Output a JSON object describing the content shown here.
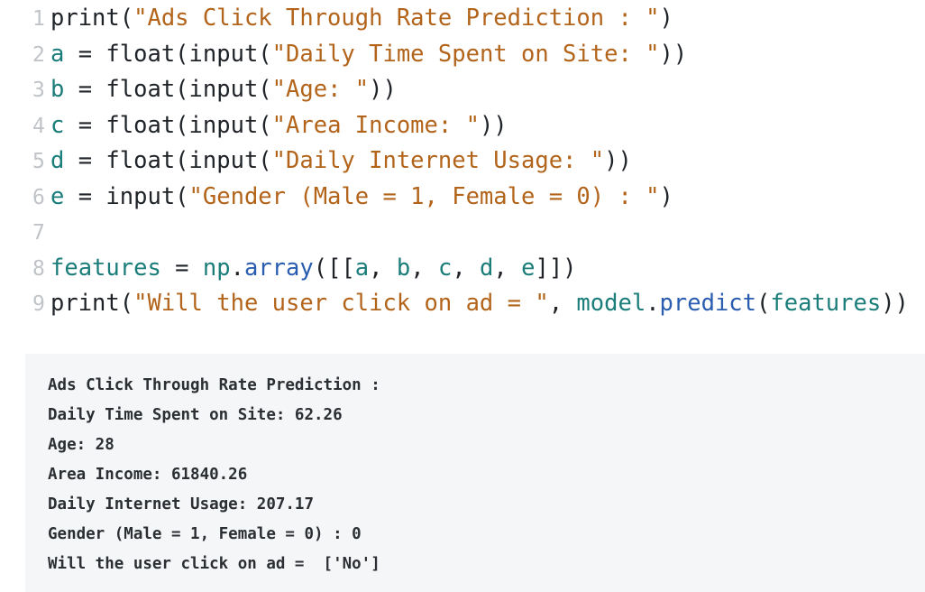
{
  "code": {
    "lines": [
      {
        "num": "1",
        "tokens": [
          {
            "t": "print(",
            "c": "fn"
          },
          {
            "t": "\"Ads Click Through Rate Prediction : \"",
            "c": "str"
          },
          {
            "t": ")",
            "c": "plain"
          }
        ]
      },
      {
        "num": "2",
        "tokens": [
          {
            "t": "a",
            "c": "var"
          },
          {
            "t": " = float(input(",
            "c": "plain"
          },
          {
            "t": "\"Daily Time Spent on Site: \"",
            "c": "str"
          },
          {
            "t": "))",
            "c": "plain"
          }
        ]
      },
      {
        "num": "3",
        "tokens": [
          {
            "t": "b",
            "c": "var"
          },
          {
            "t": " = float(input(",
            "c": "plain"
          },
          {
            "t": "\"Age: \"",
            "c": "str"
          },
          {
            "t": "))",
            "c": "plain"
          }
        ]
      },
      {
        "num": "4",
        "tokens": [
          {
            "t": "c",
            "c": "var"
          },
          {
            "t": " = float(input(",
            "c": "plain"
          },
          {
            "t": "\"Area Income: \"",
            "c": "str"
          },
          {
            "t": "))",
            "c": "plain"
          }
        ]
      },
      {
        "num": "5",
        "tokens": [
          {
            "t": "d",
            "c": "var"
          },
          {
            "t": " = float(input(",
            "c": "plain"
          },
          {
            "t": "\"Daily Internet Usage: \"",
            "c": "str"
          },
          {
            "t": "))",
            "c": "plain"
          }
        ]
      },
      {
        "num": "6",
        "tokens": [
          {
            "t": "e",
            "c": "var"
          },
          {
            "t": " = input(",
            "c": "plain"
          },
          {
            "t": "\"Gender (Male = 1, Female = 0) : \"",
            "c": "str"
          },
          {
            "t": ")",
            "c": "plain"
          }
        ]
      },
      {
        "num": "7",
        "tokens": []
      },
      {
        "num": "8",
        "tokens": [
          {
            "t": "features",
            "c": "var"
          },
          {
            "t": " = ",
            "c": "plain"
          },
          {
            "t": "np",
            "c": "var"
          },
          {
            "t": ".",
            "c": "plain"
          },
          {
            "t": "array",
            "c": "meth"
          },
          {
            "t": "([[",
            "c": "plain"
          },
          {
            "t": "a",
            "c": "var"
          },
          {
            "t": ", ",
            "c": "plain"
          },
          {
            "t": "b",
            "c": "var"
          },
          {
            "t": ", ",
            "c": "plain"
          },
          {
            "t": "c",
            "c": "var"
          },
          {
            "t": ", ",
            "c": "plain"
          },
          {
            "t": "d",
            "c": "var"
          },
          {
            "t": ", ",
            "c": "plain"
          },
          {
            "t": "e",
            "c": "var"
          },
          {
            "t": "]])",
            "c": "plain"
          }
        ]
      },
      {
        "num": "9",
        "tokens": [
          {
            "t": "print(",
            "c": "fn"
          },
          {
            "t": "\"Will the user click on ad = \"",
            "c": "str"
          },
          {
            "t": ", ",
            "c": "plain"
          },
          {
            "t": "model",
            "c": "var"
          },
          {
            "t": ".",
            "c": "plain"
          },
          {
            "t": "predict",
            "c": "meth"
          },
          {
            "t": "(",
            "c": "plain"
          },
          {
            "t": "features",
            "c": "var"
          },
          {
            "t": "))",
            "c": "plain"
          }
        ]
      }
    ]
  },
  "output": {
    "lines": [
      "Ads Click Through Rate Prediction :",
      "Daily Time Spent on Site: 62.26",
      "Age: 28",
      "Area Income: 61840.26",
      "Daily Internet Usage: 207.17",
      "Gender (Male = 1, Female = 0) : 0",
      "Will the user click on ad =  ['No']"
    ]
  },
  "colors": {
    "string": "#b3641b",
    "variable": "#1a7d7a",
    "method": "#2a5db0",
    "line_number": "#c0c4c8",
    "output_background": "#f5f6f7"
  }
}
